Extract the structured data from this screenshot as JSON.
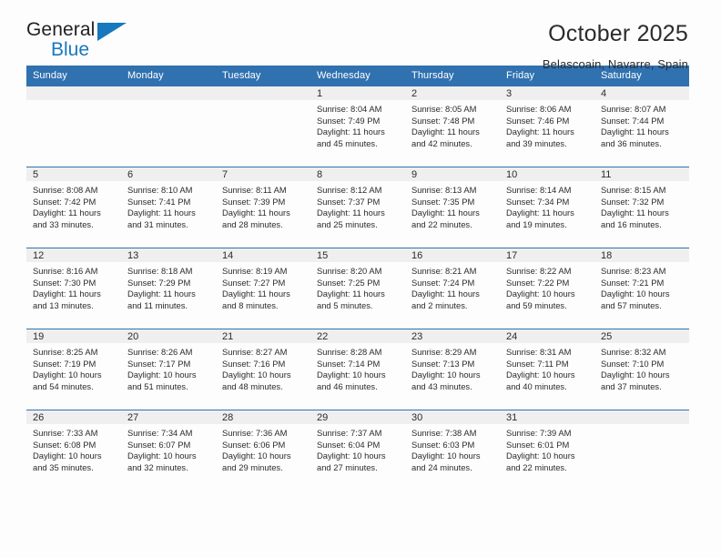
{
  "brand": {
    "name_part1": "General",
    "name_part2": "Blue",
    "logo_icon": "blue-triangle-icon",
    "accent_color": "#1878be"
  },
  "header": {
    "title": "October 2025",
    "subtitle": "Belascoain, Navarre, Spain"
  },
  "theme": {
    "header_blue": "#3071b0",
    "daynum_band": "#efefef",
    "page_bg": "#fdfdfd",
    "text": "#2b2b2b"
  },
  "calendar": {
    "weekday_headers": [
      "Sunday",
      "Monday",
      "Tuesday",
      "Wednesday",
      "Thursday",
      "Friday",
      "Saturday"
    ],
    "labels": {
      "sunrise": "Sunrise:",
      "sunset": "Sunset:",
      "daylight": "Daylight:"
    },
    "weeks": [
      [
        {
          "day": "",
          "empty": true
        },
        {
          "day": "",
          "empty": true
        },
        {
          "day": "",
          "empty": true
        },
        {
          "day": "1",
          "sunrise": "Sunrise: 8:04 AM",
          "sunset": "Sunset: 7:49 PM",
          "daylight_l1": "Daylight: 11 hours",
          "daylight_l2": "and 45 minutes."
        },
        {
          "day": "2",
          "sunrise": "Sunrise: 8:05 AM",
          "sunset": "Sunset: 7:48 PM",
          "daylight_l1": "Daylight: 11 hours",
          "daylight_l2": "and 42 minutes."
        },
        {
          "day": "3",
          "sunrise": "Sunrise: 8:06 AM",
          "sunset": "Sunset: 7:46 PM",
          "daylight_l1": "Daylight: 11 hours",
          "daylight_l2": "and 39 minutes."
        },
        {
          "day": "4",
          "sunrise": "Sunrise: 8:07 AM",
          "sunset": "Sunset: 7:44 PM",
          "daylight_l1": "Daylight: 11 hours",
          "daylight_l2": "and 36 minutes."
        }
      ],
      [
        {
          "day": "5",
          "sunrise": "Sunrise: 8:08 AM",
          "sunset": "Sunset: 7:42 PM",
          "daylight_l1": "Daylight: 11 hours",
          "daylight_l2": "and 33 minutes."
        },
        {
          "day": "6",
          "sunrise": "Sunrise: 8:10 AM",
          "sunset": "Sunset: 7:41 PM",
          "daylight_l1": "Daylight: 11 hours",
          "daylight_l2": "and 31 minutes."
        },
        {
          "day": "7",
          "sunrise": "Sunrise: 8:11 AM",
          "sunset": "Sunset: 7:39 PM",
          "daylight_l1": "Daylight: 11 hours",
          "daylight_l2": "and 28 minutes."
        },
        {
          "day": "8",
          "sunrise": "Sunrise: 8:12 AM",
          "sunset": "Sunset: 7:37 PM",
          "daylight_l1": "Daylight: 11 hours",
          "daylight_l2": "and 25 minutes."
        },
        {
          "day": "9",
          "sunrise": "Sunrise: 8:13 AM",
          "sunset": "Sunset: 7:35 PM",
          "daylight_l1": "Daylight: 11 hours",
          "daylight_l2": "and 22 minutes."
        },
        {
          "day": "10",
          "sunrise": "Sunrise: 8:14 AM",
          "sunset": "Sunset: 7:34 PM",
          "daylight_l1": "Daylight: 11 hours",
          "daylight_l2": "and 19 minutes."
        },
        {
          "day": "11",
          "sunrise": "Sunrise: 8:15 AM",
          "sunset": "Sunset: 7:32 PM",
          "daylight_l1": "Daylight: 11 hours",
          "daylight_l2": "and 16 minutes."
        }
      ],
      [
        {
          "day": "12",
          "sunrise": "Sunrise: 8:16 AM",
          "sunset": "Sunset: 7:30 PM",
          "daylight_l1": "Daylight: 11 hours",
          "daylight_l2": "and 13 minutes."
        },
        {
          "day": "13",
          "sunrise": "Sunrise: 8:18 AM",
          "sunset": "Sunset: 7:29 PM",
          "daylight_l1": "Daylight: 11 hours",
          "daylight_l2": "and 11 minutes."
        },
        {
          "day": "14",
          "sunrise": "Sunrise: 8:19 AM",
          "sunset": "Sunset: 7:27 PM",
          "daylight_l1": "Daylight: 11 hours",
          "daylight_l2": "and 8 minutes."
        },
        {
          "day": "15",
          "sunrise": "Sunrise: 8:20 AM",
          "sunset": "Sunset: 7:25 PM",
          "daylight_l1": "Daylight: 11 hours",
          "daylight_l2": "and 5 minutes."
        },
        {
          "day": "16",
          "sunrise": "Sunrise: 8:21 AM",
          "sunset": "Sunset: 7:24 PM",
          "daylight_l1": "Daylight: 11 hours",
          "daylight_l2": "and 2 minutes."
        },
        {
          "day": "17",
          "sunrise": "Sunrise: 8:22 AM",
          "sunset": "Sunset: 7:22 PM",
          "daylight_l1": "Daylight: 10 hours",
          "daylight_l2": "and 59 minutes."
        },
        {
          "day": "18",
          "sunrise": "Sunrise: 8:23 AM",
          "sunset": "Sunset: 7:21 PM",
          "daylight_l1": "Daylight: 10 hours",
          "daylight_l2": "and 57 minutes."
        }
      ],
      [
        {
          "day": "19",
          "sunrise": "Sunrise: 8:25 AM",
          "sunset": "Sunset: 7:19 PM",
          "daylight_l1": "Daylight: 10 hours",
          "daylight_l2": "and 54 minutes."
        },
        {
          "day": "20",
          "sunrise": "Sunrise: 8:26 AM",
          "sunset": "Sunset: 7:17 PM",
          "daylight_l1": "Daylight: 10 hours",
          "daylight_l2": "and 51 minutes."
        },
        {
          "day": "21",
          "sunrise": "Sunrise: 8:27 AM",
          "sunset": "Sunset: 7:16 PM",
          "daylight_l1": "Daylight: 10 hours",
          "daylight_l2": "and 48 minutes."
        },
        {
          "day": "22",
          "sunrise": "Sunrise: 8:28 AM",
          "sunset": "Sunset: 7:14 PM",
          "daylight_l1": "Daylight: 10 hours",
          "daylight_l2": "and 46 minutes."
        },
        {
          "day": "23",
          "sunrise": "Sunrise: 8:29 AM",
          "sunset": "Sunset: 7:13 PM",
          "daylight_l1": "Daylight: 10 hours",
          "daylight_l2": "and 43 minutes."
        },
        {
          "day": "24",
          "sunrise": "Sunrise: 8:31 AM",
          "sunset": "Sunset: 7:11 PM",
          "daylight_l1": "Daylight: 10 hours",
          "daylight_l2": "and 40 minutes."
        },
        {
          "day": "25",
          "sunrise": "Sunrise: 8:32 AM",
          "sunset": "Sunset: 7:10 PM",
          "daylight_l1": "Daylight: 10 hours",
          "daylight_l2": "and 37 minutes."
        }
      ],
      [
        {
          "day": "26",
          "sunrise": "Sunrise: 7:33 AM",
          "sunset": "Sunset: 6:08 PM",
          "daylight_l1": "Daylight: 10 hours",
          "daylight_l2": "and 35 minutes."
        },
        {
          "day": "27",
          "sunrise": "Sunrise: 7:34 AM",
          "sunset": "Sunset: 6:07 PM",
          "daylight_l1": "Daylight: 10 hours",
          "daylight_l2": "and 32 minutes."
        },
        {
          "day": "28",
          "sunrise": "Sunrise: 7:36 AM",
          "sunset": "Sunset: 6:06 PM",
          "daylight_l1": "Daylight: 10 hours",
          "daylight_l2": "and 29 minutes."
        },
        {
          "day": "29",
          "sunrise": "Sunrise: 7:37 AM",
          "sunset": "Sunset: 6:04 PM",
          "daylight_l1": "Daylight: 10 hours",
          "daylight_l2": "and 27 minutes."
        },
        {
          "day": "30",
          "sunrise": "Sunrise: 7:38 AM",
          "sunset": "Sunset: 6:03 PM",
          "daylight_l1": "Daylight: 10 hours",
          "daylight_l2": "and 24 minutes."
        },
        {
          "day": "31",
          "sunrise": "Sunrise: 7:39 AM",
          "sunset": "Sunset: 6:01 PM",
          "daylight_l1": "Daylight: 10 hours",
          "daylight_l2": "and 22 minutes."
        },
        {
          "day": "",
          "empty": true
        }
      ]
    ]
  }
}
